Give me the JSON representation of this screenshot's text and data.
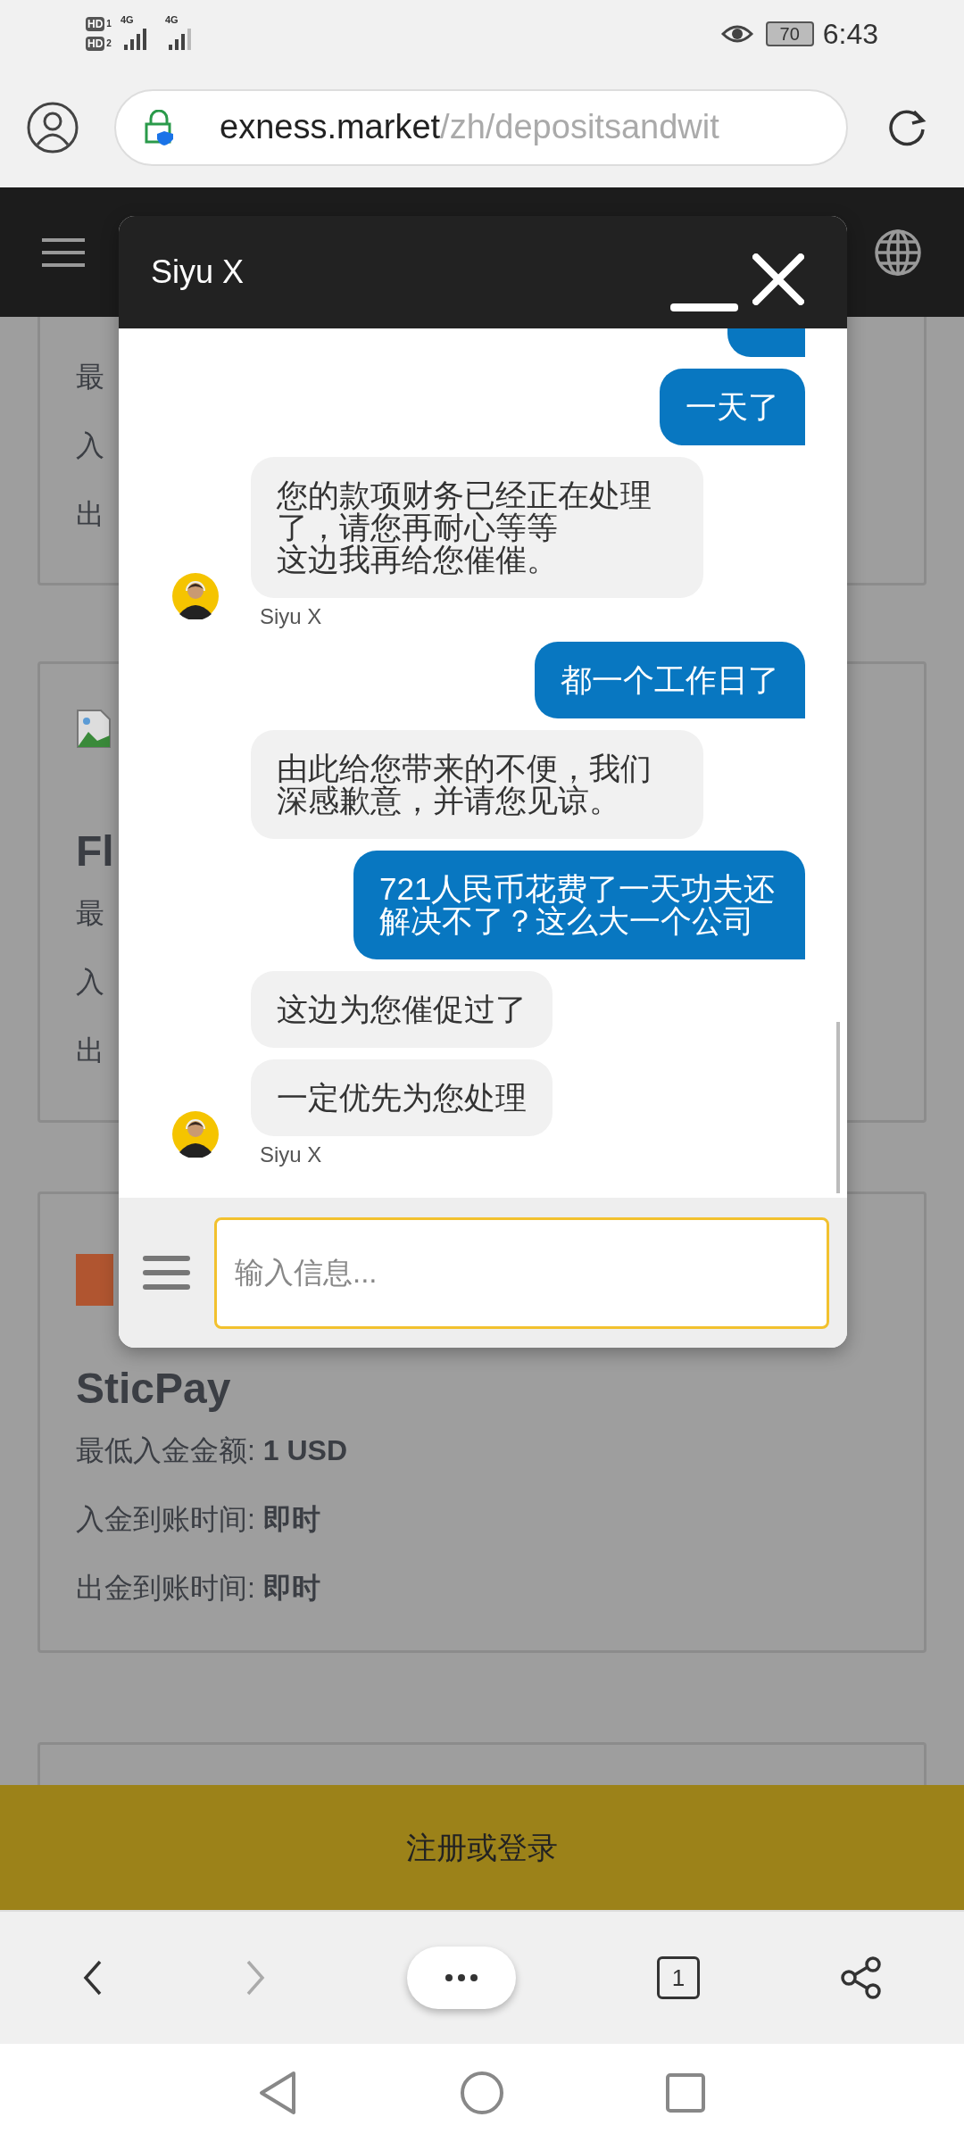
{
  "status_bar": {
    "sims": [
      {
        "badge": "HD",
        "slot": "1",
        "tech": "4G"
      },
      {
        "badge": "HD",
        "slot": "2",
        "tech": "4G"
      }
    ],
    "battery": "70",
    "time": "6:43"
  },
  "address_bar": {
    "host": "exness.market",
    "path": "/zh/depositsandwit"
  },
  "page": {
    "cards": [
      {
        "kind": "text",
        "rows": [
          {
            "label": "最"
          },
          {
            "label": "入"
          },
          {
            "label": "出"
          }
        ]
      },
      {
        "kind": "broken-image",
        "title": "Fl",
        "rows": [
          {
            "label": "最"
          },
          {
            "label": "入"
          },
          {
            "label": "出"
          }
        ]
      },
      {
        "kind": "logo",
        "title": "SticPay",
        "rows": [
          {
            "label": "最低入金金额: ",
            "value": "1 USD"
          },
          {
            "label": "入金到账时间: ",
            "value": "即时"
          },
          {
            "label": "出金到账时间: ",
            "value": "即时"
          }
        ]
      },
      {
        "kind": "cut-off"
      }
    ],
    "cta": "注册或登录"
  },
  "chat": {
    "title": "Siyu X",
    "messages": [
      {
        "kind": "sent-cut"
      },
      {
        "kind": "sent",
        "text": "一天了"
      },
      {
        "kind": "received",
        "paragraphs": [
          "您的款项财务已经正在处理了，请您再耐心等等",
          "这边我再给您催催。"
        ],
        "avatar": true,
        "sender": "Siyu X"
      },
      {
        "kind": "sent",
        "text": "都一个工作日了"
      },
      {
        "kind": "received",
        "text": "由此给您带来的不便，我们深感歉意，并请您见谅。"
      },
      {
        "kind": "sent",
        "text": "721人民币花费了一天功夫还解决不了？这么大一个公司"
      },
      {
        "kind": "received",
        "text": "这边为您催促过了"
      },
      {
        "kind": "received",
        "text": "一定优先为您处理",
        "avatar": true,
        "sender": "Siyu X"
      }
    ],
    "input": {
      "placeholder": "输入信息..."
    }
  },
  "browser_toolbar": {
    "tab_count": "1"
  }
}
